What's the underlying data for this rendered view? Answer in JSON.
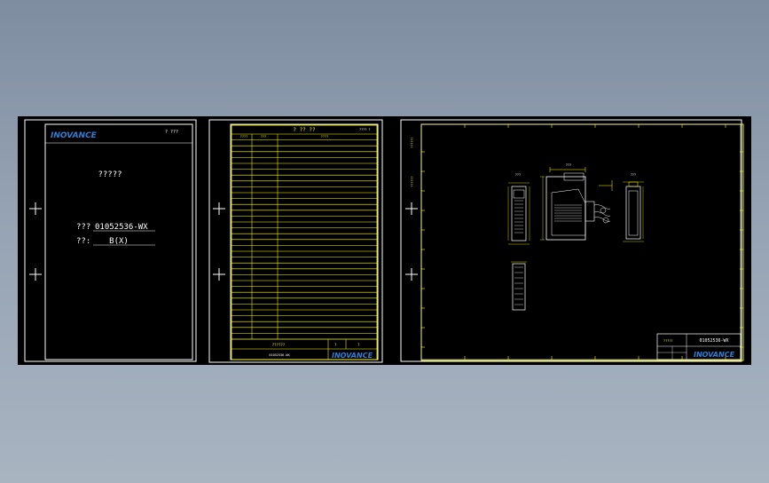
{
  "sheet1": {
    "brand": "INOVANCE",
    "header_right": "?  ???",
    "title": "?????",
    "doc_label": "???",
    "doc_number": "01052536-WX",
    "version_label": "??:",
    "version_value": "B(X)"
  },
  "sheet2": {
    "title": "? ?? ??",
    "header_right": "???? ?",
    "col1": "????",
    "col2": "???",
    "col3": "????",
    "footer_center": "??????",
    "footer_left": "01052536-WX",
    "footer_mark1": "?",
    "footer_mark2": "?",
    "brand": "INOVANCE"
  },
  "sheet3": {
    "side_label_top": "??????",
    "side_label_mid": "??????",
    "view_label_left": "???",
    "view_label_center": "???",
    "view_label_right": "???",
    "tb_label": "?????",
    "tb_number": "01052536-WX",
    "brand": "INOVANCE"
  },
  "colors": {
    "background": "#000000",
    "frame": "#ffffff",
    "drawing": "#ffff00",
    "brand": "#2f7fd6"
  }
}
